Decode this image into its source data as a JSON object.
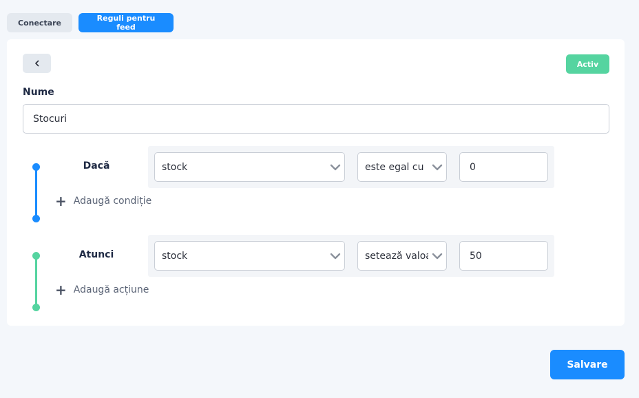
{
  "tabs": [
    {
      "label": "Conectare",
      "active": false
    },
    {
      "label": "Reguli pentru feed",
      "active": true
    }
  ],
  "card": {
    "back_icon": "chevron-left-icon",
    "status": "Activ",
    "status_color": "#55d4a0",
    "name_label": "Nume",
    "name_value": "Stocuri"
  },
  "condition_block": {
    "label": "Dacă",
    "color": "#1a8cff",
    "field": "stock",
    "operator": "este egal cu",
    "value": "0",
    "add_label": "Adaugă condiție"
  },
  "action_block": {
    "label": "Atunci",
    "color": "#55d4a0",
    "field": "stock",
    "operator": "setează valoarea",
    "value": "50",
    "add_label": "Adaugă acțiune"
  },
  "save_label": "Salvare",
  "accent_color": "#1a8cff"
}
